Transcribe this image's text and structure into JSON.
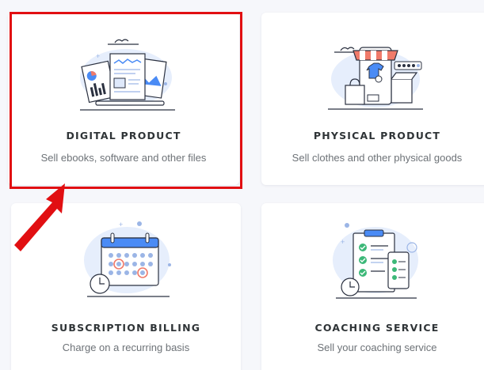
{
  "cards": [
    {
      "title": "DIGITAL PRODUCT",
      "description": "Sell ebooks, software and other files",
      "icon": "digital-product-illustration"
    },
    {
      "title": "PHYSICAL PRODUCT",
      "description": "Sell clothes and other physical goods",
      "icon": "physical-product-illustration"
    },
    {
      "title": "SUBSCRIPTION BILLING",
      "description": "Charge on a recurring basis",
      "icon": "subscription-calendar-illustration"
    },
    {
      "title": "COACHING SERVICE",
      "description": "Sell your coaching service",
      "icon": "coaching-checklist-illustration"
    }
  ],
  "colors": {
    "highlight": "#e10f12",
    "illustration_blue": "#4a8bf5",
    "illustration_light": "#dfe9fb",
    "stroke": "#2b3140",
    "accent_red": "#f07a6a",
    "accent_green": "#3cb878"
  }
}
